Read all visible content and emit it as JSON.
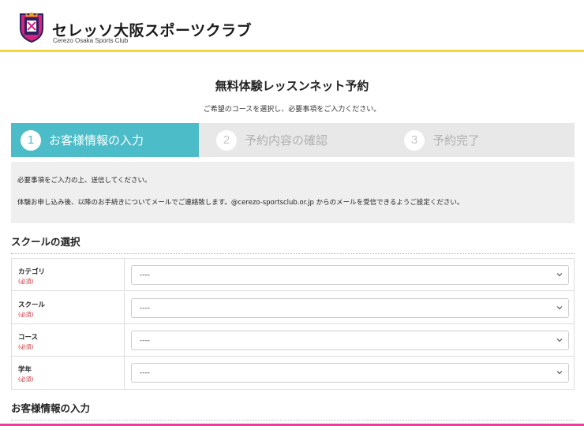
{
  "header": {
    "brand_name": "セレッソ大阪スポーツクラブ",
    "brand_sub": "Cerezo Osaka Sports Club",
    "accent_color": "#f5d63a"
  },
  "page": {
    "title": "無料体験レッスンネット予約",
    "subtitle": "ご希望のコースを選択し、必要事項をご入力ください。"
  },
  "steps": [
    {
      "num": "1",
      "label": "お客様情報の入力",
      "active": true
    },
    {
      "num": "2",
      "label": "予約内容の確認",
      "active": false
    },
    {
      "num": "3",
      "label": "予約完了",
      "active": false
    }
  ],
  "notice": {
    "line1": "必要事項をご入力の上、送信してください。",
    "line2": "体験お申し込み後、以降のお手続きについてメールでご連絡致します。@cerezo-sportsclub.or.jp からのメールを受信できるようご設定ください。"
  },
  "school_section": {
    "title": "スクールの選択",
    "rows": [
      {
        "label": "カテゴリ",
        "required": "(必須)",
        "value": "----"
      },
      {
        "label": "スクール",
        "required": "(必須)",
        "value": "----"
      },
      {
        "label": "コース",
        "required": "(必須)",
        "value": "----"
      },
      {
        "label": "学年",
        "required": "(必須)",
        "value": "----"
      }
    ]
  },
  "customer_section": {
    "title": "お客様情報の入力"
  },
  "colors": {
    "step_active": "#4cbcc8",
    "required": "#d0232a",
    "bottom_accent": "#e8409a"
  }
}
